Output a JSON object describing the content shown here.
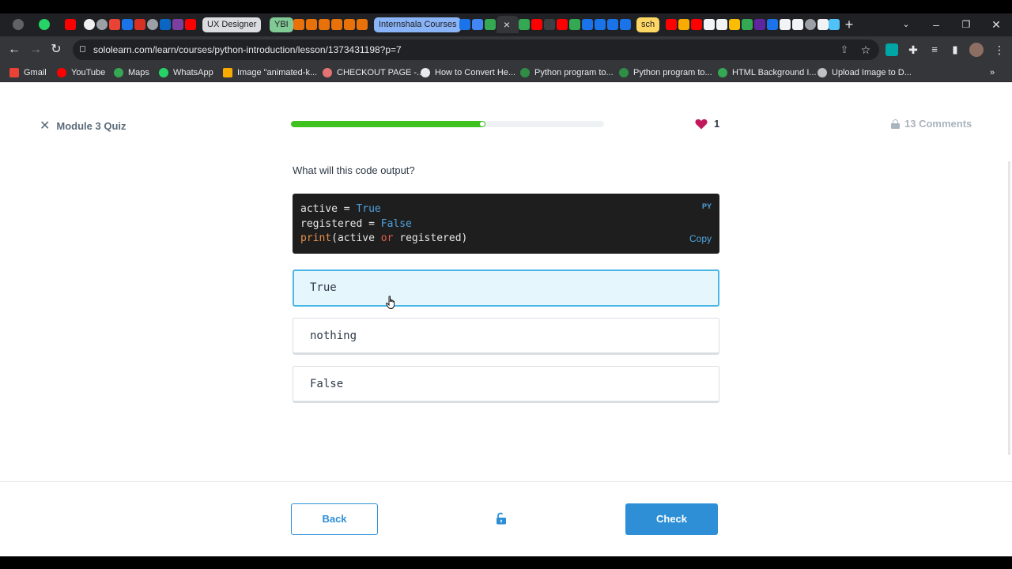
{
  "browser": {
    "tab_groups": [
      "UX Designer",
      "YBI",
      "Internshala Courses",
      "sch"
    ],
    "url": "sololearn.com/learn/courses/python-introduction/lesson/1373431198?p=7",
    "bookmarks": [
      "Gmail",
      "YouTube",
      "Maps",
      "WhatsApp",
      "Image \"animated-k...",
      "CHECKOUT PAGE -...",
      "How to Convert He...",
      "Python program to...",
      "Python program to...",
      "HTML Background I...",
      "Upload Image to D..."
    ]
  },
  "quiz": {
    "title": "Module 3 Quiz",
    "progress_fraction": 0.62,
    "hearts": "1",
    "comments": "13 Comments",
    "question": "What will this code output?"
  },
  "code": {
    "language": "PY",
    "copy_label": "Copy",
    "line1": {
      "a": "active = ",
      "b": "True"
    },
    "line2": {
      "a": "registered = ",
      "b": "False"
    },
    "line3": {
      "fn": "print",
      "a": "(active ",
      "op": "or",
      "b": " registered)"
    }
  },
  "options": [
    {
      "label": "True",
      "selected": true
    },
    {
      "label": "nothing",
      "selected": false
    },
    {
      "label": "False",
      "selected": false
    }
  ],
  "footer": {
    "back_label": "Back",
    "check_label": "Check"
  },
  "colors": {
    "progress": "#3fc21f",
    "primary": "#2e8fd6",
    "heart": "#c2185b",
    "selected_bg": "#e6f6fd",
    "selected_border": "#49b6e5"
  }
}
